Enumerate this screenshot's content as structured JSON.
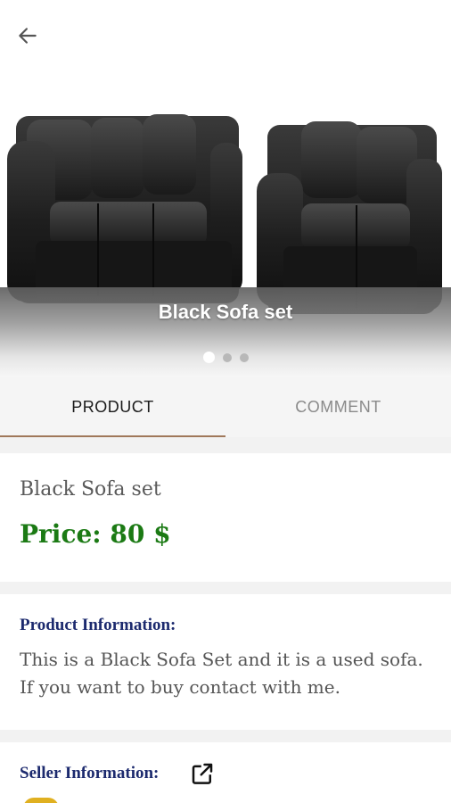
{
  "header": {
    "back_icon": "arrow-left-icon"
  },
  "carousel": {
    "title": "Black Sofa set",
    "image_subject": "black leather sofa set",
    "slide_count": 3,
    "active_slide": 1
  },
  "tabs": [
    {
      "label": "PRODUCT",
      "active": true
    },
    {
      "label": "COMMENT",
      "active": false
    }
  ],
  "product": {
    "name": "Black Sofa set",
    "price": "Price: 80 $"
  },
  "product_info": {
    "heading": "Product Information:",
    "body": "This is a Black Sofa Set and it is a used sofa. If you want to buy contact with me."
  },
  "seller": {
    "heading": "Seller Information:",
    "link_icon": "open-external-icon"
  },
  "colors": {
    "price": "#1b7a14",
    "heading": "#1c2a6e",
    "tab_indicator": "#a0785a",
    "title_text": "#ffffff"
  }
}
